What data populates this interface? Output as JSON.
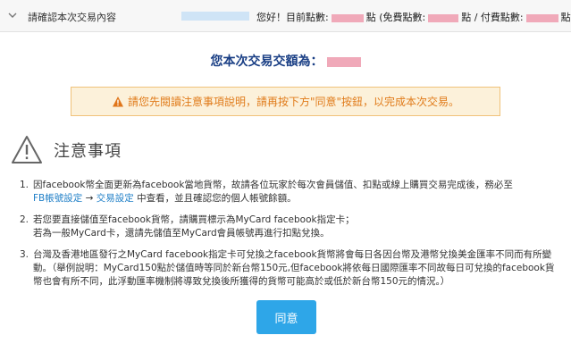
{
  "header": {
    "title": "請確認本次交易內容",
    "greeting": "您好！目前點數:",
    "unit1": "點",
    "free_label": "(免費點數:",
    "unit2": "點",
    "paid_label": "/ 付費點數:",
    "unit3": "點)"
  },
  "amount": {
    "label": "您本次交易交額為："
  },
  "notice": {
    "text": "請您先閱讀注意事項說明，請再按下方\"同意\"按鈕，以完成本次交易。"
  },
  "section": {
    "title": "注意事項"
  },
  "notes": [
    {
      "num": "1.",
      "text_a": "因facebook幣全面更新為facebook當地貨幣，故請各位玩家於每次會員儲值、扣點或線上購買交易完成後，務必至",
      "link1": "FB帳號設定",
      "arrow": "→",
      "link2": "交易設定",
      "text_b": "中查看，並且確認您的個人帳號餘額。"
    },
    {
      "num": "2.",
      "line1": "若您要直接儲值至facebook貨幣，請購買標示為MyCard facebook指定卡；",
      "line2": "若為一般MyCard卡，還請先儲值至MyCard會員帳號再進行扣點兌換。"
    },
    {
      "num": "3.",
      "text": "台灣及香港地區發行之MyCard facebook指定卡可兌換之facebook貨幣將會每日各因台幣及港幣兌換美金匯率不同而有所變動。（舉例說明：MyCard150點於儲值時等同於新台幣150元,但facebook將依每日國際匯率不同故每日可兌換的facebook貨幣也會有所不同，此浮動匯率機制將導致兌換後所獲得的貨幣可能高於或低於新台幣150元的情況。）"
    }
  ],
  "button": {
    "agree_label": "同意"
  },
  "colors": {
    "accent": "#2ea6e8",
    "title_blue": "#1a3f85",
    "warning_orange": "#e07b1a",
    "link_blue": "#1f7fc7"
  }
}
